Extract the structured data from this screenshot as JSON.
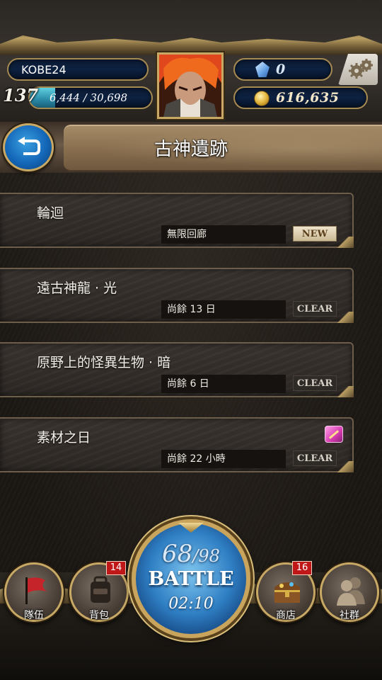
{
  "player": {
    "name": "KOBE24",
    "level": "137",
    "exp": "6,444 / 30,698",
    "exp_fraction": 0.21,
    "gems": "0",
    "gold": "616,635"
  },
  "page": {
    "title": "古神遺跡"
  },
  "quests": [
    {
      "name": "輪迴",
      "info": "無限回廊",
      "tag": "NEW",
      "material_icon": false
    },
    {
      "name": "遠古神龍 · 光",
      "info": "尚餘 13 日",
      "tag": "CLEAR",
      "material_icon": false
    },
    {
      "name": "原野上的怪異生物 · 暗",
      "info": "尚餘 6 日",
      "tag": "CLEAR",
      "material_icon": false
    },
    {
      "name": "素材之日",
      "info": "尚餘 22 小時",
      "tag": "CLEAR",
      "material_icon": true
    }
  ],
  "nav": {
    "team": {
      "label": "隊伍",
      "icon": "flag-icon"
    },
    "bag": {
      "label": "背包",
      "icon": "backpack-icon",
      "badge": "14"
    },
    "shop": {
      "label": "商店",
      "icon": "treasure-chest-icon",
      "badge": "16"
    },
    "social": {
      "label": "社群",
      "icon": "people-icon"
    }
  },
  "battle": {
    "stamina_current": "68",
    "stamina_max": "/98",
    "label": "BATTLE",
    "timer": "02:10"
  },
  "colors": {
    "accent_gold": "#c7a865",
    "pill_navy": "#0d2140",
    "exp_cyan": "#2a8aa8",
    "badge_red": "#c01818",
    "battle_blue": "#2f7fc4"
  }
}
